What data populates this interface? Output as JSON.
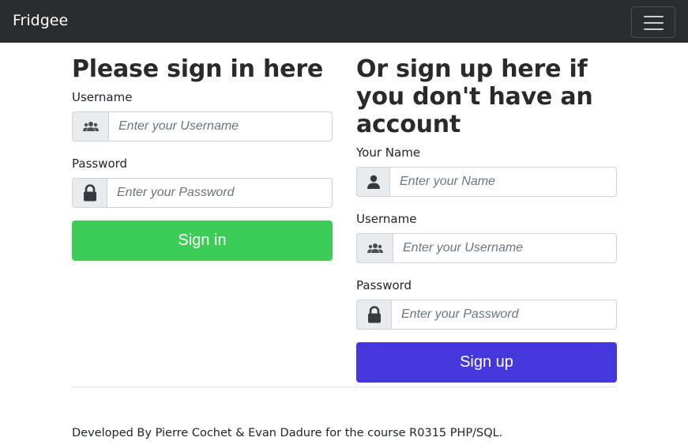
{
  "navbar": {
    "brand": "Fridgee",
    "menu_icon": "hamburger-icon"
  },
  "signin": {
    "heading": "Please sign in here",
    "username_label": "Username",
    "username_placeholder": "Enter your Username",
    "username_icon": "users-icon",
    "password_label": "Password",
    "password_placeholder": "Enter your Password",
    "password_icon": "lock-icon",
    "button_label": "Sign in",
    "button_color": "#3ccd58"
  },
  "signup": {
    "heading": "Or sign up here if you don't have an account",
    "name_label": "Your Name",
    "name_placeholder": "Enter your Name",
    "name_icon": "user-icon",
    "username_label": "Username",
    "username_placeholder": "Enter your Username",
    "username_icon": "users-icon",
    "password_label": "Password",
    "password_placeholder": "Enter your Password",
    "password_icon": "lock-icon",
    "button_label": "Sign up",
    "button_color": "#4438dc"
  },
  "footer": {
    "text": "Developed By Pierre Cochet & Evan Dadure for the course R0315 PHP/SQL."
  }
}
